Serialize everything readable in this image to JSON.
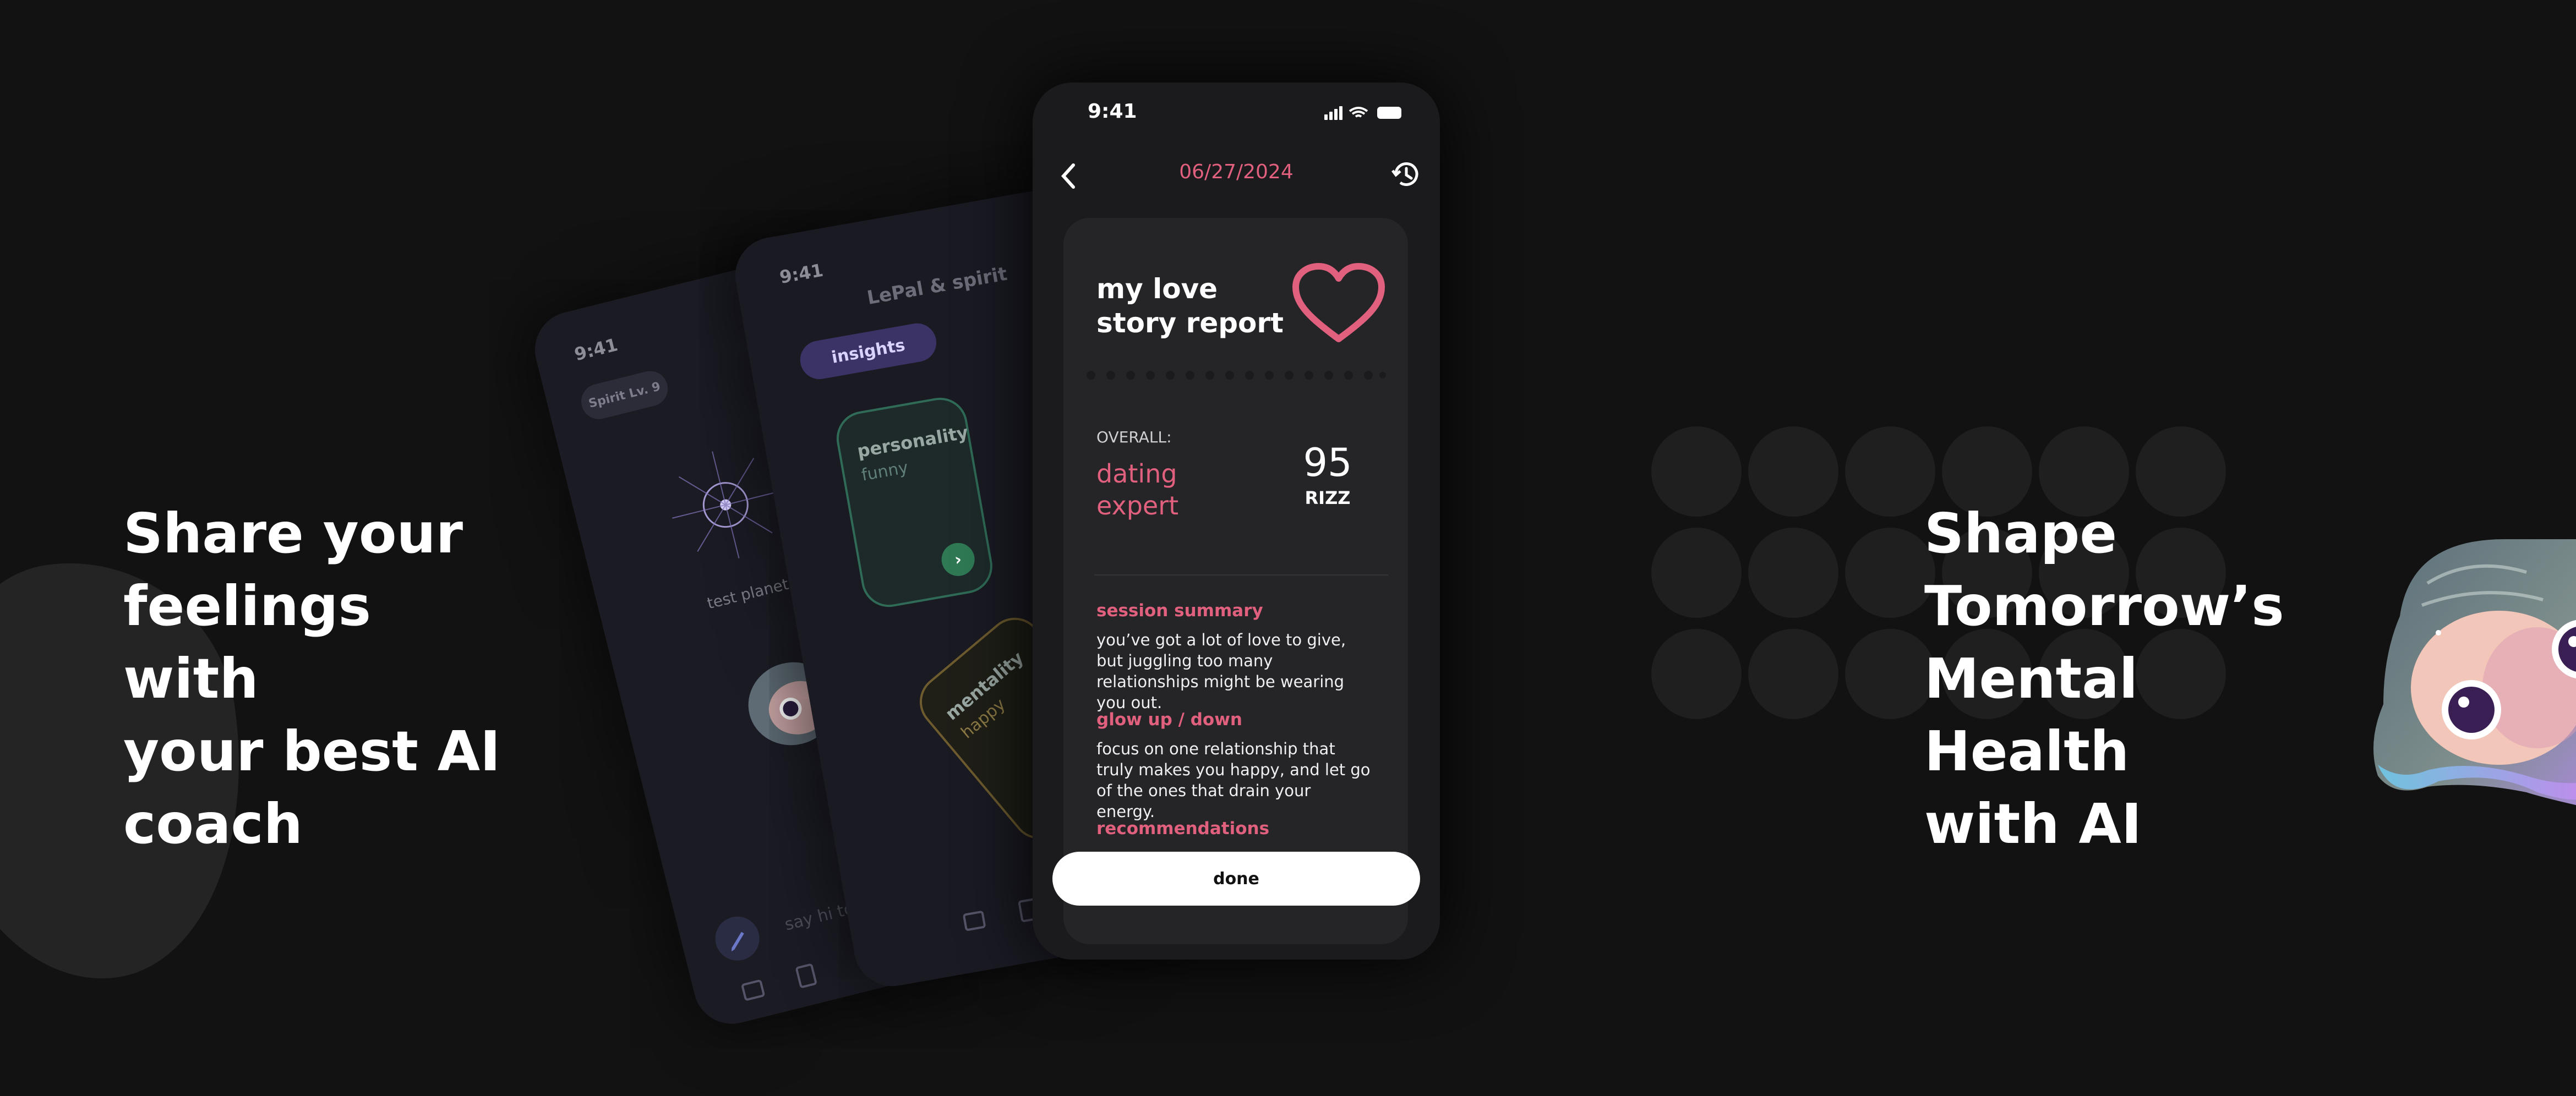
{
  "headlines": {
    "left": "Share your\nfeelings with\nyour best AI\ncoach",
    "right": "Shape\nTomorrow’s\nMental Health\nwith AI"
  },
  "back_phone_1": {
    "time": "9:41",
    "spirit_label": "Spirit",
    "level": "Lv. 9",
    "planet": "test\nplanet",
    "chat_placeholder": "say hi to yo"
  },
  "back_phone_2": {
    "time": "9:41",
    "title": "LePal & spirit",
    "tab_active": "insights",
    "card1": {
      "title": "personality",
      "value": "funny"
    },
    "card2": {
      "title": "mentality",
      "value": "happy"
    }
  },
  "main_phone": {
    "time": "9:41",
    "date": "06/27/2024",
    "report": {
      "title": "my love\nstory report",
      "overall_label": "OVERALL:",
      "overall_value": "dating\nexpert",
      "score": "95",
      "score_unit": "RIZZ",
      "sections": [
        {
          "heading": "session summary",
          "body": "you’ve got a lot of love to give, but juggling too many relationships might be wearing you out."
        },
        {
          "heading": "glow up / down",
          "body": "focus on one relationship that truly makes you happy, and let go of the ones that drain your energy."
        },
        {
          "heading": "recommendations",
          "body": ""
        }
      ]
    },
    "done_label": "done"
  },
  "colors": {
    "background": "#121212",
    "accent_pink": "#e0607e",
    "card": "#252528"
  }
}
